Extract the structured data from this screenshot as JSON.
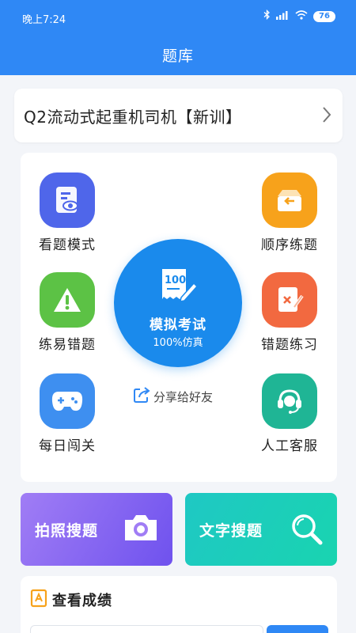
{
  "status_bar": {
    "time": "晚上7:24",
    "battery": "76"
  },
  "header": {
    "title": "题库"
  },
  "course": {
    "title": "Q2流动式起重机司机【新训】"
  },
  "grid": {
    "tiles": [
      {
        "label": "看题模式",
        "icon": "eye-document-icon",
        "color": "#4f66ea"
      },
      {
        "label": "顺序练题",
        "icon": "inbox-arrow-icon",
        "color": "#f7a21b"
      },
      {
        "label": "练易错题",
        "icon": "warning-icon",
        "color": "#5cc245"
      },
      {
        "label": "错题练习",
        "icon": "wrong-document-icon",
        "color": "#f26940"
      },
      {
        "label": "每日闯关",
        "icon": "gamepad-icon",
        "color": "#3e8ff0"
      },
      {
        "label": "人工客服",
        "icon": "headset-icon",
        "color": "#1fb595"
      }
    ],
    "exam": {
      "badge": "100",
      "title": "模拟考试",
      "subtitle": "100%仿真"
    },
    "share": {
      "label": "分享给好友"
    }
  },
  "search": {
    "photo": {
      "label": "拍照搜题",
      "icon": "camera-icon"
    },
    "text": {
      "label": "文字搜题",
      "icon": "magnifier-icon"
    }
  },
  "score": {
    "title": "查看成绩",
    "icon": "score-badge-icon"
  }
}
